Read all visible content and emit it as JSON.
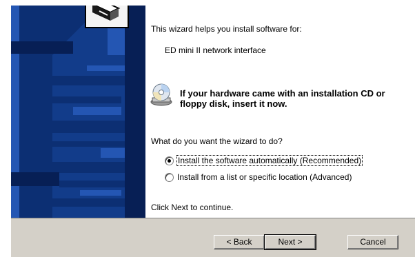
{
  "content": {
    "intro": "This wizard helps you install software for:",
    "device_name": "ED mini II network interface",
    "cd_message": "If your hardware came with an installation CD or floppy disk, insert it now.",
    "question": "What do you want the wizard to do?",
    "options": [
      {
        "label": "Install the software automatically (Recommended)",
        "selected": true
      },
      {
        "label": "Install from a list or specific location (Advanced)",
        "selected": false
      }
    ],
    "continue_text": "Click Next to continue."
  },
  "buttons": {
    "back": "< Back",
    "next": "Next >",
    "cancel": "Cancel"
  },
  "icons": {
    "banner": "hardware-wizard-icon",
    "cd": "cd-drive-icon"
  },
  "colors": {
    "banner": "#123c8a",
    "button_bar": "#d4d0c8"
  }
}
